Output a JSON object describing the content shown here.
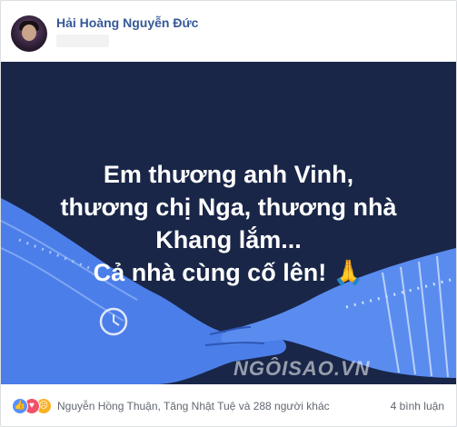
{
  "post": {
    "author": "Hải Hoàng Nguyễn Đức",
    "image_text": [
      "Em thương anh Vinh,",
      "thương chị Nga, thương nhà",
      "Khang lắm...",
      "Cả nhà cùng cố lên! 🙏"
    ],
    "watermark": "NGÔISAO.VN"
  },
  "footer": {
    "reactions": [
      {
        "name": "like",
        "color": "#5890ff",
        "glyph": "👍"
      },
      {
        "name": "love",
        "color": "#f25268",
        "glyph": "♥"
      },
      {
        "name": "sad",
        "color": "#f7b125",
        "glyph": "☹"
      }
    ],
    "reactors_text": "Nguyễn Hồng Thuận, Tăng Nhật Tuệ và 288 người khác",
    "comments_text": "4 bình luận"
  },
  "colors": {
    "image_background": "#192648",
    "hand_color": "#4b7ee8",
    "author_link": "#365899"
  }
}
